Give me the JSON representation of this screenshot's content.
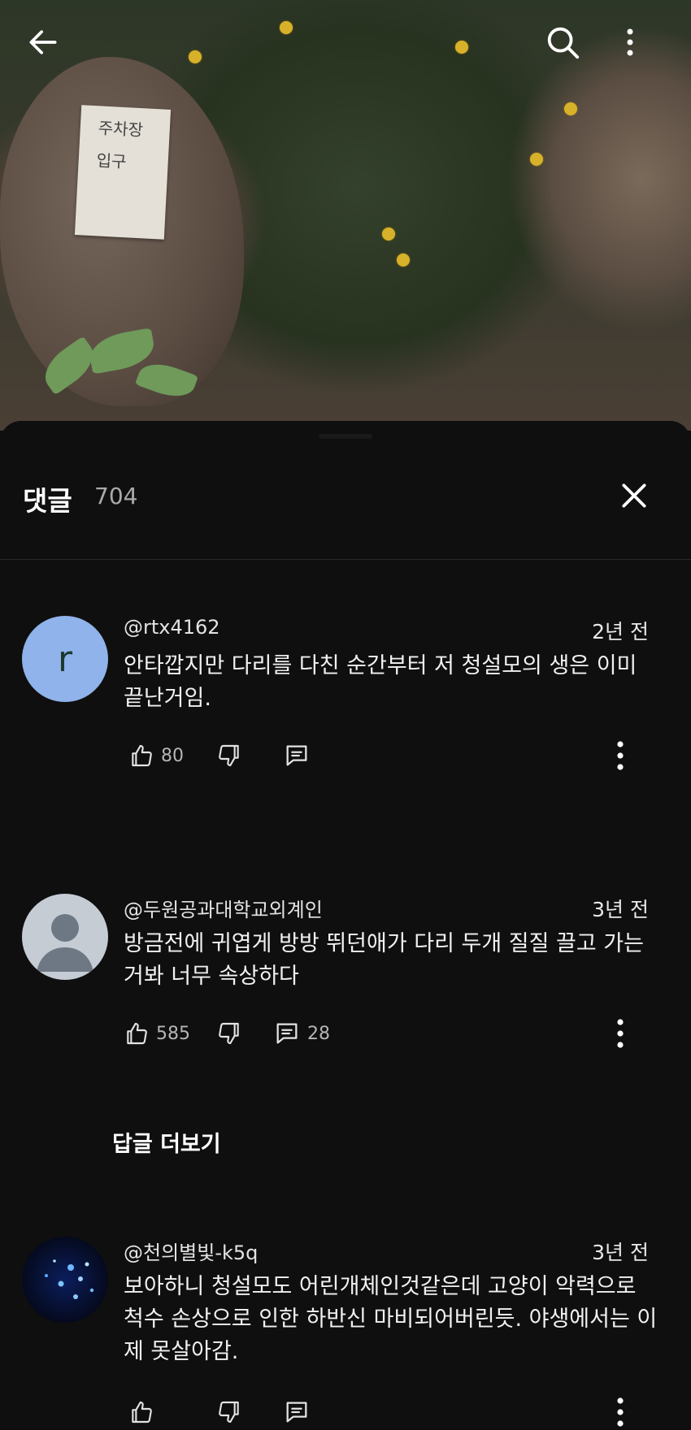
{
  "video": {
    "sign_lines": [
      "주차장",
      "입구"
    ],
    "back_icon": "arrow-left-icon",
    "search_icon": "search-icon",
    "more_icon": "more-vertical-icon"
  },
  "sheet": {
    "title": "댓글",
    "count": "704",
    "close_icon": "close-icon"
  },
  "comments": [
    {
      "author": "@rtx4162",
      "avatar_letter": "r",
      "time": "2년 전",
      "text": "안타깝지만 다리를 다친 순간부터 저 청설모의 생은 이미 끝난거임.",
      "likes": "80",
      "replies": ""
    },
    {
      "author": "@두원공과대학교외계인",
      "time": "3년 전",
      "text": "방금전에 귀엽게 방방 뛰던애가 다리 두개 질질 끌고 가는거봐 너무 속상하다",
      "likes": "585",
      "replies": "28",
      "more_replies_label": "답글 더보기"
    },
    {
      "author": "@천의별빛-k5q",
      "time": "3년 전",
      "text": "보아하니 청설모도 어린개체인것같은데 고양이 악력으로 척수 손상으로 인한 하반신 마비되어버린듯. 야생에서는 이제 못살아감.",
      "likes": "",
      "replies": ""
    }
  ],
  "colors": {
    "background": "#0f0f0f",
    "avatar_r": "#8fb3ea",
    "avatar_default": "#c5ccd4"
  }
}
